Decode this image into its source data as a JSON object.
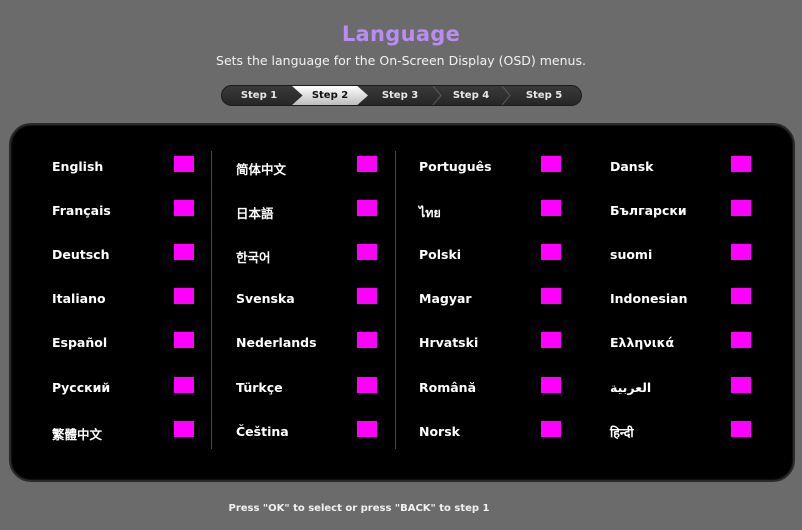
{
  "header": {
    "title": "Language",
    "subtitle": "Sets the language for the On-Screen Display (OSD) menus."
  },
  "steps": [
    {
      "label": "Step 1",
      "active": false
    },
    {
      "label": "Step 2",
      "active": true
    },
    {
      "label": "Step 3",
      "active": false
    },
    {
      "label": "Step 4",
      "active": false
    },
    {
      "label": "Step 5",
      "active": false
    }
  ],
  "languages": {
    "col1": [
      "English",
      "Français",
      "Deutsch",
      "Italiano",
      "Español",
      "Русский",
      "繁體中文"
    ],
    "col2": [
      "简体中文",
      "日本語",
      "한국어",
      "Svenska",
      "Nederlands",
      "Türkçe",
      "Čeština"
    ],
    "col3": [
      "Português",
      "ไทย",
      "Polski",
      "Magyar",
      "Hrvatski",
      "Română",
      "Norsk"
    ],
    "col4": [
      "Dansk",
      "Български",
      "suomi",
      "Indonesian",
      "Ελληνικά",
      "العربية",
      "हिन्दी"
    ]
  },
  "colors": {
    "background": "#6b6b6b",
    "title": "#b98cf2",
    "panel": "#000000",
    "selector_box": "#ff00ff"
  },
  "footer": {
    "hint": "Press \"OK\" to select or press \"BACK\" to step 1"
  }
}
